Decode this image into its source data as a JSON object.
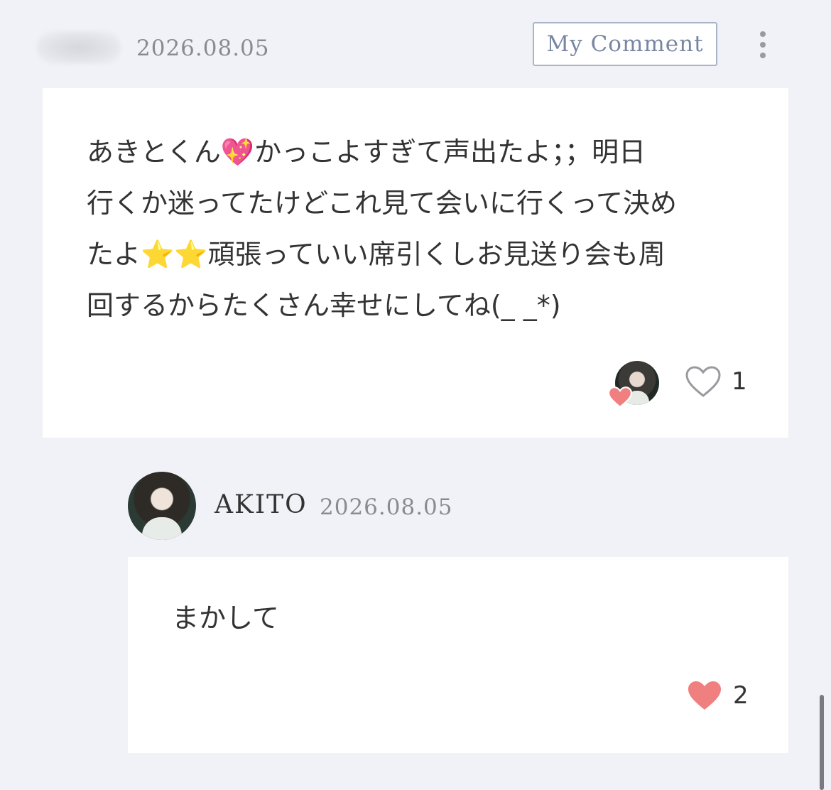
{
  "comment": {
    "author_name": "",
    "date": "2026.08.05",
    "my_comment_label": "My Comment",
    "text": "あきとくん💖かっこよすぎて声出たよ；；明日\n行くか迷ってたけどこれ見て会いに行くって決め\nたよ⭐⭐頑張っていい席引くしお見送り会も周\n回するからたくさん幸せにしてね(_ _*)",
    "like_count": "1"
  },
  "reply": {
    "author_name": "AKITO",
    "date": "2026.08.05",
    "text": "まかして",
    "like_count": "2"
  },
  "colors": {
    "background": "#f1f2f7",
    "card": "#ffffff",
    "heart_filled": "#f08080",
    "button_border": "#a9b4c9",
    "button_text": "#7886a3"
  },
  "icons": {
    "more": "vertical-ellipsis-icon",
    "like_outline": "heart-outline-icon",
    "like_filled": "heart-filled-icon"
  }
}
